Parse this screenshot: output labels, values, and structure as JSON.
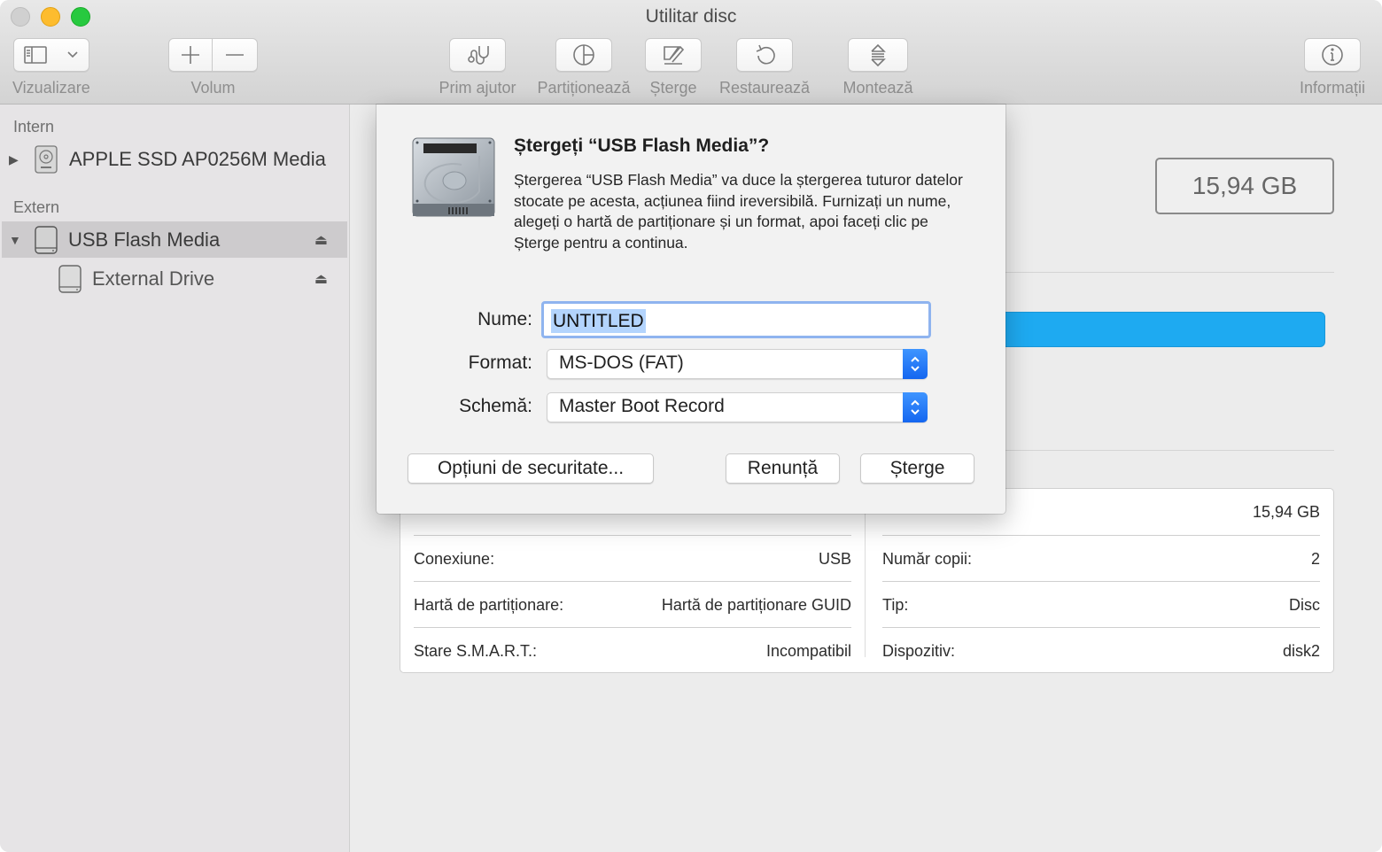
{
  "window": {
    "title": "Utilitar disc",
    "traffic_lights": {
      "close": "#d0d0d0",
      "minimize": "#fdbc2e",
      "maximize": "#27c93f"
    }
  },
  "toolbar": {
    "view": {
      "label": "Vizualizare",
      "icon": "sidebar-icon"
    },
    "volume": {
      "label": "Volum",
      "add_icon": "plus-icon",
      "remove_icon": "minus-icon"
    },
    "first_aid": {
      "label": "Prim ajutor",
      "icon": "stethoscope-icon"
    },
    "partition": {
      "label": "Partiționează",
      "icon": "pie-chart-icon"
    },
    "erase": {
      "label": "Șterge",
      "icon": "erase-icon"
    },
    "restore": {
      "label": "Restaurează",
      "icon": "restore-icon"
    },
    "mount": {
      "label": "Montează",
      "icon": "mount-icon"
    },
    "info": {
      "label": "Informații",
      "icon": "info-icon"
    }
  },
  "sidebar": {
    "sections": [
      {
        "heading": "Intern",
        "items": [
          {
            "label": "APPLE SSD AP0256M Media",
            "expanded": false,
            "selected": false
          }
        ]
      },
      {
        "heading": "Extern",
        "items": [
          {
            "label": "USB Flash Media",
            "expanded": true,
            "selected": true,
            "ejectable": true
          },
          {
            "label": "External Drive",
            "child": true,
            "selected": false,
            "ejectable": true
          }
        ]
      }
    ]
  },
  "main": {
    "capacity": "15,94 GB",
    "usage_color": "#1eaaf1",
    "info": {
      "left": [
        {
          "label": "",
          "value": ""
        },
        {
          "label": "Conexiune:",
          "value": "USB"
        },
        {
          "label": "Hartă de partiționare:",
          "value": "Hartă de partiționare GUID"
        },
        {
          "label": "Stare S.M.A.R.T.:",
          "value": "Incompatibil"
        }
      ],
      "right": [
        {
          "label": "",
          "value": "15,94 GB"
        },
        {
          "label": "Număr copii:",
          "value": "2"
        },
        {
          "label": "Tip:",
          "value": "Disc"
        },
        {
          "label": "Dispozitiv:",
          "value": "disk2"
        }
      ]
    }
  },
  "dialog": {
    "title": "Ștergeți “USB Flash Media”?",
    "message": "Ștergerea “USB Flash Media” va duce la ștergerea tuturor datelor stocate pe acesta, acțiunea fiind ireversibilă. Furnizați un nume, alegeți o hartă de partiționare și un format, apoi faceți clic pe Șterge pentru a continua.",
    "name_label": "Nume:",
    "name_value": "UNTITLED",
    "format_label": "Format:",
    "format_value": "MS-DOS (FAT)",
    "scheme_label": "Schemă:",
    "scheme_value": "Master Boot Record",
    "security_button": "Opțiuni de securitate...",
    "cancel_button": "Renunță",
    "erase_button": "Șterge"
  }
}
